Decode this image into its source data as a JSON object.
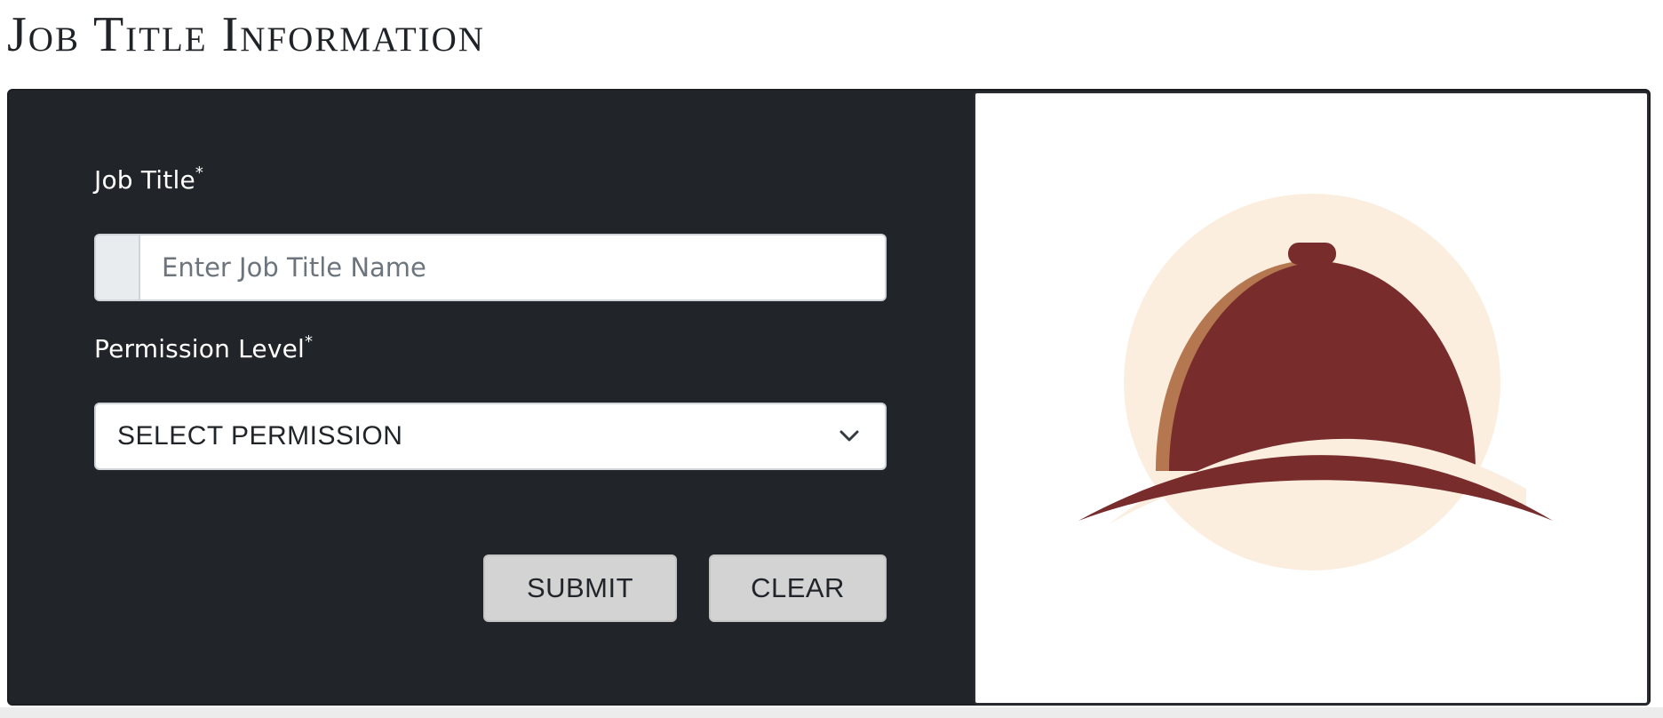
{
  "page": {
    "title": "Job Title Information"
  },
  "form": {
    "job_title": {
      "label": "Job Title",
      "required_mark": "*",
      "value": "",
      "placeholder": "Enter Job Title Name"
    },
    "permission": {
      "label": "Permission Level",
      "required_mark": "*",
      "selected": "SELECT PERMISSION",
      "icon": "chevron-down-icon"
    },
    "buttons": {
      "submit": "SUBMIT",
      "clear": "CLEAR"
    }
  },
  "illustration": {
    "icon": "service-bell-icon",
    "colors": {
      "circle": "#fbeede",
      "bell": "#782c2c",
      "bell_highlight": "#b47750"
    }
  },
  "colors": {
    "panel_bg": "#212428",
    "button_bg": "#d3d3d3",
    "label_text": "#ffffff"
  }
}
